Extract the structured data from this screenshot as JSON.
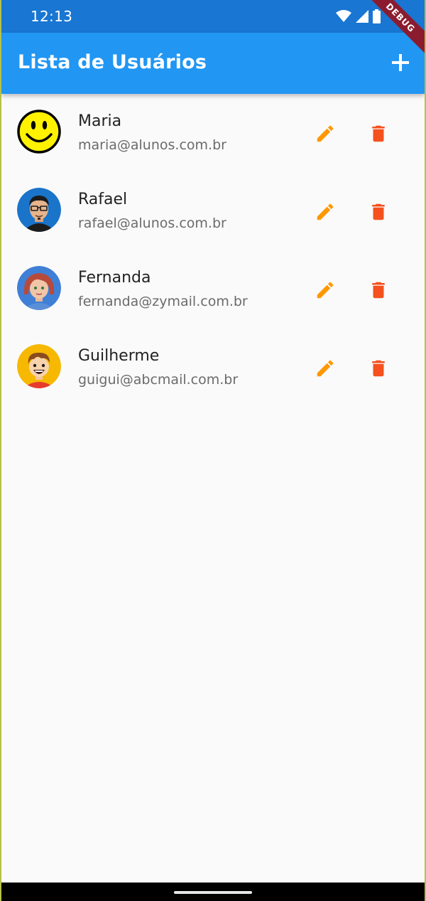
{
  "status_bar": {
    "time": "12:13",
    "icons": [
      "wifi-icon",
      "cell-signal-icon",
      "battery-icon"
    ]
  },
  "debug_banner": "DEBUG",
  "app_bar": {
    "title": "Lista de Usuários",
    "action_icon": "plus-icon"
  },
  "users": [
    {
      "name": "Maria",
      "email": "maria@alunos.com.br",
      "avatar": "smiley-avatar"
    },
    {
      "name": "Rafael",
      "email": "rafael@alunos.com.br",
      "avatar": "man-glasses-avatar"
    },
    {
      "name": "Fernanda",
      "email": "fernanda@zymail.com.br",
      "avatar": "woman-red-hair-avatar"
    },
    {
      "name": "Guilherme",
      "email": "guigui@abcmail.com.br",
      "avatar": "boy-avatar"
    }
  ],
  "row_actions": {
    "edit_icon": "pencil-icon",
    "delete_icon": "trash-icon"
  },
  "colors": {
    "status_bar": "#1976d2",
    "app_bar": "#2196f3",
    "edit": "#ff9800",
    "delete": "#f4511e",
    "background": "#fafafa"
  }
}
